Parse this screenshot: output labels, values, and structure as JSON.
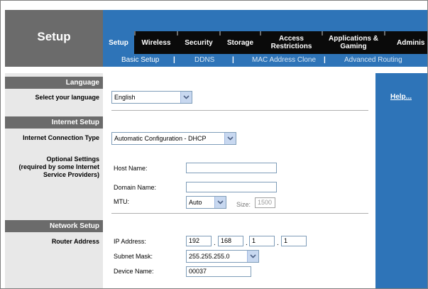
{
  "header": {
    "title": "Setup",
    "tabs": [
      {
        "label": "Setup",
        "active": true
      },
      {
        "label": "Wireless"
      },
      {
        "label": "Security"
      },
      {
        "label": "Storage"
      },
      {
        "label": "Access\nRestrictions"
      },
      {
        "label": "Applications &\nGaming"
      },
      {
        "label": "Adminis"
      }
    ],
    "subtabs": [
      {
        "label": "Basic Setup",
        "active": true
      },
      {
        "label": "DDNS"
      },
      {
        "label": "MAC Address Clone"
      },
      {
        "label": "Advanced Routing"
      }
    ],
    "separator": "|"
  },
  "sections": {
    "language": {
      "title": "Language",
      "label": "Select your language",
      "selected": "English"
    },
    "internet_setup": {
      "title": "Internet Setup",
      "connection_type_label": "Internet Connection Type",
      "connection_type_selected": "Automatic Configuration - DHCP",
      "optional_settings_label": "Optional Settings\n(required by some Internet\nService Providers)",
      "host_name_label": "Host Name:",
      "host_name_value": "",
      "domain_name_label": "Domain Name:",
      "domain_name_value": "",
      "mtu_label": "MTU:",
      "mtu_selected": "Auto",
      "size_label": "Size:",
      "size_value": "1500"
    },
    "network_setup": {
      "title": "Network Setup",
      "router_address_label": "Router Address",
      "ip_label": "IP Address:",
      "ip_octets": [
        "192",
        "168",
        "1",
        "1"
      ],
      "ip_dot": ".",
      "subnet_label": "Subnet Mask:",
      "subnet_selected": "255.255.255.0",
      "device_name_label": "Device Name:",
      "device_name_value": "00037"
    }
  },
  "help": {
    "label": "Help..."
  },
  "colors": {
    "accent": "#2e74b8",
    "header_gray": "#6b6b6b",
    "tab_black": "#0a0a0a",
    "label_bg": "#e8e8e8"
  }
}
